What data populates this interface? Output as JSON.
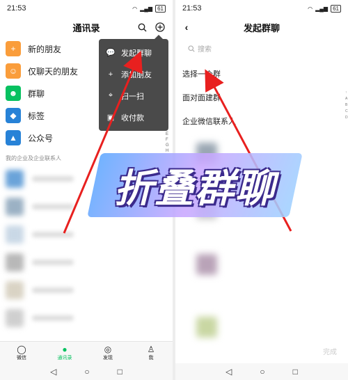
{
  "colors": {
    "accent": "#07c160",
    "popup_bg": "#4a4a4a",
    "arrow": "#e8201f",
    "title_text": "#ffffff"
  },
  "overlay": {
    "title": "折叠群聊"
  },
  "left": {
    "status": {
      "time": "21:53",
      "battery": "61"
    },
    "nav": {
      "title": "通讯录",
      "search_icon": "search-icon",
      "add_icon": "add-circle-icon"
    },
    "contacts": [
      {
        "label": "新的朋友",
        "color": "#fa9d3b",
        "icon": "person-add-icon",
        "glyph": "+"
      },
      {
        "label": "仅聊天的朋友",
        "color": "#fa9d3b",
        "icon": "person-icon",
        "glyph": "☺"
      },
      {
        "label": "群聊",
        "color": "#07c160",
        "icon": "group-icon",
        "glyph": "☻"
      },
      {
        "label": "标签",
        "color": "#2782d7",
        "icon": "tag-icon",
        "glyph": "◆"
      },
      {
        "label": "公众号",
        "color": "#2782d7",
        "icon": "official-account-icon",
        "glyph": "▲"
      }
    ],
    "section": "我的企业及企业联系人",
    "popup": [
      {
        "label": "发起群聊",
        "icon": "chat-icon",
        "glyph": "💬"
      },
      {
        "label": "添加朋友",
        "icon": "add-friend-icon",
        "glyph": "+"
      },
      {
        "label": "扫一扫",
        "icon": "scan-icon",
        "glyph": "⌖"
      },
      {
        "label": "收付款",
        "icon": "payment-icon",
        "glyph": "▣"
      }
    ],
    "alpha": [
      "E",
      "F",
      "G",
      "H"
    ],
    "tabs": [
      {
        "label": "微信",
        "icon": "chat-bubble-icon",
        "glyph": "◯"
      },
      {
        "label": "通讯录",
        "icon": "contacts-icon",
        "glyph": "●"
      },
      {
        "label": "发现",
        "icon": "compass-icon",
        "glyph": "◎"
      },
      {
        "label": "我",
        "icon": "me-icon",
        "glyph": "♙"
      }
    ]
  },
  "right": {
    "status": {
      "time": "21:53",
      "battery": "61"
    },
    "nav": {
      "title": "发起群聊",
      "back_icon": "back-arrow-icon"
    },
    "search_placeholder": "搜索",
    "options": [
      "选择一个群",
      "面对面建群",
      "企业微信联系人"
    ],
    "done": "完成",
    "strip": [
      "↑",
      "A",
      "B",
      "C",
      "D"
    ]
  }
}
